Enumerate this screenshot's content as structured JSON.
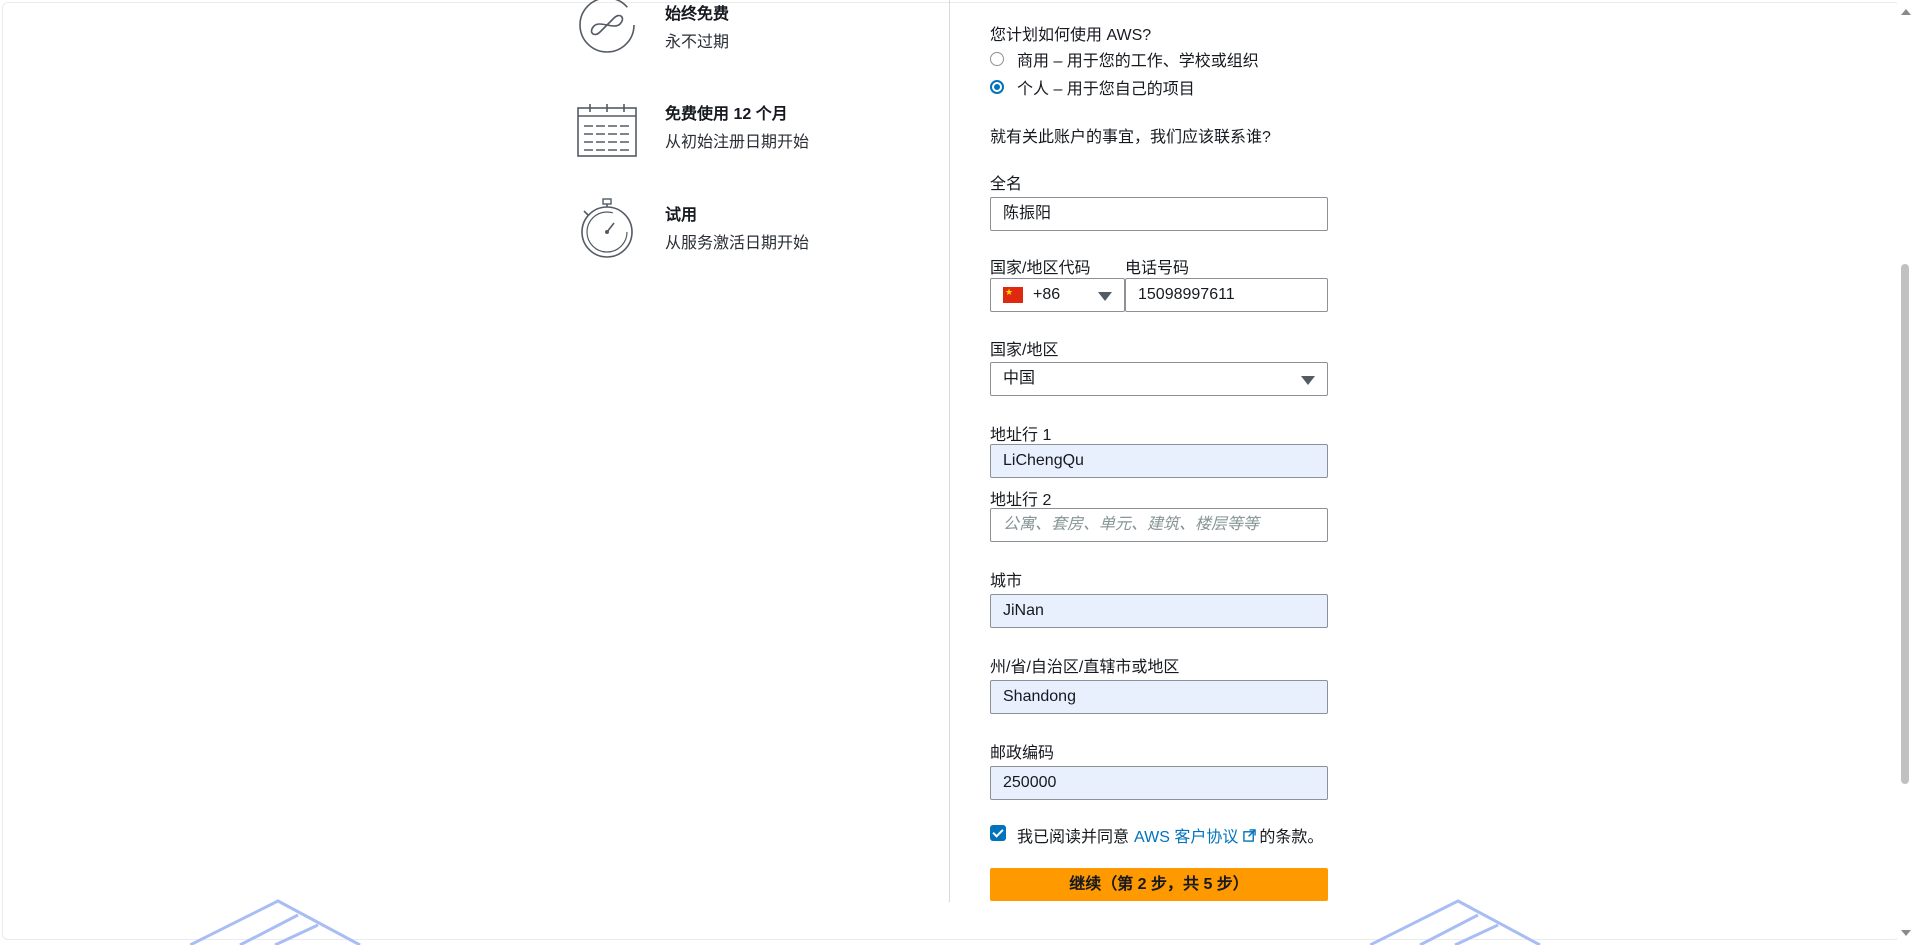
{
  "benefits": [
    {
      "title": "始终免费",
      "subtitle": "永不过期",
      "icon": "infinity-icon"
    },
    {
      "title": "免费使用 12 个月",
      "subtitle": "从初始注册日期开始",
      "icon": "calendar-icon"
    },
    {
      "title": "试用",
      "subtitle": "从服务激活日期开始",
      "icon": "stopwatch-icon"
    }
  ],
  "form": {
    "usage_question": "您计划如何使用 AWS?",
    "usage_options": [
      {
        "label": "商用 – 用于您的工作、学校或组织",
        "selected": false
      },
      {
        "label": "个人 – 用于您自己的项目",
        "selected": true
      }
    ],
    "contact_question": "就有关此账户的事宜，我们应该联系谁?",
    "full_name_label": "全名",
    "full_name_value": "陈振阳",
    "country_code_label": "国家/地区代码",
    "country_code_value": "+86",
    "phone_label": "电话号码",
    "phone_value": "15098997611",
    "country_label": "国家/地区",
    "country_value": "中国",
    "address1_label": "地址行 1",
    "address1_value": "LiChengQu",
    "address2_label": "地址行 2",
    "address2_placeholder": "公寓、套房、单元、建筑、楼层等等",
    "city_label": "城市",
    "city_value": "JiNan",
    "state_label": "州/省/自治区/直辖市或地区",
    "state_value": "Shandong",
    "postal_label": "邮政编码",
    "postal_value": "250000",
    "agreement_prefix": "我已阅读并同意",
    "agreement_link": "AWS 客户协议",
    "agreement_suffix": "的条款。",
    "agreement_checked": true,
    "continue_label": "继续（第 2 步，共 5 步）"
  },
  "colors": {
    "accent": "#0073bb",
    "button": "#ff9900",
    "autofill": "#e8f0fe"
  }
}
